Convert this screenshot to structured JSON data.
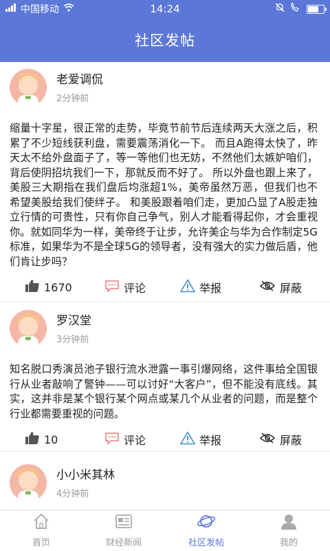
{
  "status": {
    "carrier": "中国移动",
    "time": "14:24"
  },
  "header": {
    "title": "社区发帖"
  },
  "posts": [
    {
      "name": "老爱调侃",
      "time": "2分钟前",
      "content": "缩量十字星，很正常的走势，毕竟节前节后连续两天大涨之后，积累了不少短线获利盘，需要震荡消化一下。 而且A跑得太快了，昨天太不给外盘面子了，等一等他们也无妨，不然他们太嫉妒咱们，背后使阴招坑我们一下，那就反而不好了。 所以外盘也跟上来了，美股三大期指在我们盘后均涨超1%，美帝虽然万恶，但我们也不希望美股给我们使绊子。 和美股跟着咱们走，更加凸显了A股走独立行情的可贵性，只有你自己争气，别人才能看得起你，才会重视你。就如同华为一样，美帝终于让步，允许美企与华为合作制定5G标准，如果华为不是全球5G的领导者，没有强大的实力做后盾，他们肯让步吗？",
      "likes": "1670"
    },
    {
      "name": "罗汉堂",
      "time": "3分钟前",
      "content": "知名脱口秀演员池子银行流水泄露一事引爆网络，这件事给全国银行从业者敲响了警钟——可以讨好“大客户”，但不能没有底线。其实，这并非是某个银行某个网点或某几个从业者的问题，而是整个行业都需要重视的问题。",
      "likes": "10"
    },
    {
      "name": "小小米其林",
      "time": "4分钟前",
      "content": "",
      "likes": ""
    }
  ],
  "labels": {
    "comment": "评论",
    "report": "举报",
    "hide": "屏蔽"
  },
  "tabs": [
    {
      "label": "首页",
      "icon": "home-icon",
      "active": false
    },
    {
      "label": "财经新闻",
      "icon": "news-icon",
      "active": false
    },
    {
      "label": "社区发帖",
      "icon": "planet-icon",
      "active": true
    },
    {
      "label": "我的",
      "icon": "user-icon",
      "active": false
    }
  ],
  "colors": {
    "primary": "#5b78d8",
    "like": "#555555",
    "comment": "#e87a7a",
    "report": "#3a8fd6",
    "hide": "#333333"
  }
}
